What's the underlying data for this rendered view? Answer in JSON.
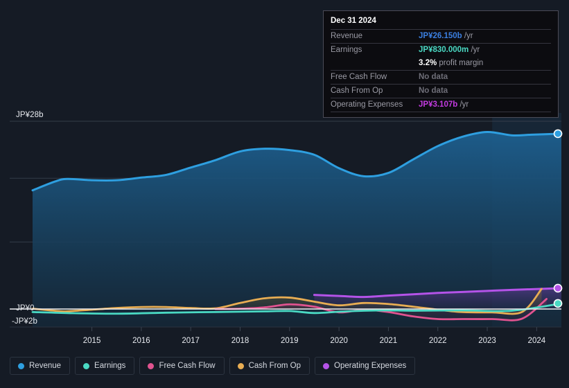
{
  "chart_data": {
    "type": "area",
    "title": "",
    "xlabel": "",
    "ylabel": "",
    "currency": "JP¥",
    "ylim": [
      -2,
      28
    ],
    "y_ticks": [
      {
        "label": "JP¥28b",
        "value": 28
      },
      {
        "label": "JP¥0",
        "value": 0
      },
      {
        "label": "-JP¥2b",
        "value": -2
      }
    ],
    "gridlines": [
      28,
      19.5,
      10,
      0
    ],
    "grid": true,
    "legend_position": "bottom",
    "x_ticks": [
      "2015",
      "2016",
      "2017",
      "2018",
      "2019",
      "2020",
      "2021",
      "2022",
      "2023",
      "2024"
    ],
    "x_range": [
      2014.3,
      2025.0
    ],
    "forecast_start": "2023.6",
    "series": [
      {
        "name": "Revenue",
        "color": "#2e9fe0",
        "fill": true,
        "x": [
          2014.3,
          2014.75,
          2015.0,
          2015.5,
          2016.0,
          2016.5,
          2017.0,
          2017.5,
          2018.0,
          2018.5,
          2019.0,
          2019.5,
          2020.0,
          2020.5,
          2021.0,
          2021.5,
          2022.0,
          2022.5,
          2023.0,
          2023.5,
          2024.0,
          2024.4,
          2025.0
        ],
        "values": [
          17.7,
          19.0,
          19.4,
          19.2,
          19.2,
          19.6,
          20.0,
          21.1,
          22.2,
          23.5,
          23.9,
          23.7,
          23.0,
          21.0,
          19.8,
          20.3,
          22.3,
          24.3,
          25.7,
          26.4,
          25.9,
          26.0,
          26.15
        ]
      },
      {
        "name": "Earnings",
        "color": "#4ad9c3",
        "fill": false,
        "x": [
          2014.3,
          2015.0,
          2016.0,
          2017.0,
          2018.0,
          2019.0,
          2019.5,
          2020.0,
          2020.5,
          2021.0,
          2021.5,
          2022.0,
          2023.0,
          2024.0,
          2025.0
        ],
        "values": [
          -0.45,
          -0.6,
          -0.7,
          -0.55,
          -0.45,
          -0.35,
          -0.3,
          -0.6,
          -0.4,
          -0.25,
          -0.2,
          -0.25,
          -0.2,
          -0.25,
          0.83
        ]
      },
      {
        "name": "Free Cash Flow",
        "color": "#e0538f",
        "fill": false,
        "x": [
          2018.0,
          2018.5,
          2019.0,
          2019.5,
          2020.0,
          2020.5,
          2021.0,
          2021.5,
          2022.0,
          2022.5,
          2023.0,
          2023.6,
          2024.2,
          2024.7
        ],
        "values": [
          0.0,
          0.05,
          0.25,
          0.7,
          0.35,
          -0.5,
          -0.1,
          -0.45,
          -1.1,
          -1.5,
          -1.5,
          -1.5,
          -1.45,
          1.5
        ]
      },
      {
        "name": "Cash From Op",
        "color": "#e8ad53",
        "fill": false,
        "x": [
          2014.3,
          2014.8,
          2015.0,
          2015.5,
          2016.0,
          2016.5,
          2017.0,
          2017.5,
          2018.0,
          2018.5,
          2019.0,
          2019.5,
          2020.0,
          2020.5,
          2021.0,
          2021.5,
          2022.0,
          2022.5,
          2023.0,
          2023.6,
          2024.2,
          2024.6
        ],
        "values": [
          0.05,
          -0.3,
          -0.35,
          -0.1,
          0.15,
          0.3,
          0.3,
          0.15,
          0.1,
          0.9,
          1.6,
          1.7,
          1.1,
          0.55,
          0.9,
          0.75,
          0.35,
          -0.1,
          -0.45,
          -0.5,
          -0.45,
          3.0
        ]
      },
      {
        "name": "Operating Expenses",
        "color": "#b453e8",
        "fill": false,
        "x": [
          2020.0,
          2020.5,
          2021.0,
          2021.5,
          2022.0,
          2022.5,
          2023.0,
          2023.5,
          2024.0,
          2025.0
        ],
        "values": [
          2.1,
          1.95,
          1.8,
          2.0,
          2.2,
          2.4,
          2.55,
          2.7,
          2.85,
          3.107
        ]
      }
    ],
    "end_markers": [
      {
        "series": "Revenue",
        "value": 26.15,
        "color": "#2e9fe0"
      },
      {
        "series": "Operating Expenses",
        "value": 3.107,
        "color": "#b453e8"
      },
      {
        "series": "Earnings",
        "value": 0.83,
        "color": "#4ad9c3"
      }
    ]
  },
  "tooltip": {
    "date": "Dec 31 2024",
    "rows": [
      {
        "key": "Revenue",
        "value": "JP¥26.150b",
        "unit": " /yr",
        "color": "#3b7fe0",
        "nodata": false
      },
      {
        "key": "Earnings",
        "value": "JP¥830.000m",
        "unit": " /yr",
        "color": "#4ad9c3",
        "nodata": false
      },
      {
        "key": "",
        "value": "3.2%",
        "unit": " profit margin",
        "color": "#ffffff",
        "nodata": false
      },
      {
        "key": "Free Cash Flow",
        "value": "No data",
        "unit": "",
        "color": "#6e6e78",
        "nodata": true
      },
      {
        "key": "Cash From Op",
        "value": "No data",
        "unit": "",
        "color": "#6e6e78",
        "nodata": true
      },
      {
        "key": "Operating Expenses",
        "value": "JP¥3.107b",
        "unit": " /yr",
        "color": "#c23be0",
        "nodata": false
      }
    ]
  },
  "legend": {
    "items": [
      {
        "label": "Revenue",
        "color": "#2e9fe0"
      },
      {
        "label": "Earnings",
        "color": "#4ad9c3"
      },
      {
        "label": "Free Cash Flow",
        "color": "#e0538f"
      },
      {
        "label": "Cash From Op",
        "color": "#e8ad53"
      },
      {
        "label": "Operating Expenses",
        "color": "#b453e8"
      }
    ]
  },
  "axis": {
    "y_top": "JP¥28b",
    "y_zero": "JP¥0",
    "y_bottom": "-JP¥2b"
  }
}
